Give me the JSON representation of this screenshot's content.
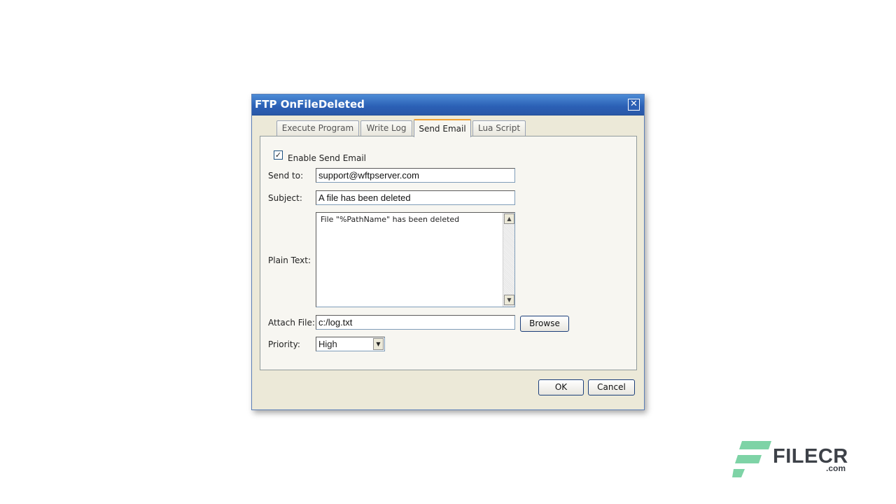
{
  "dialog": {
    "title": "FTP OnFileDeleted",
    "close_glyph": "✕"
  },
  "tabs": [
    {
      "label": "Execute Program",
      "active": false
    },
    {
      "label": "Write Log",
      "active": false
    },
    {
      "label": "Send Email",
      "active": true
    },
    {
      "label": "Lua Script",
      "active": false
    }
  ],
  "form": {
    "enable_checkbox": {
      "label": "Enable Send Email",
      "checked": true,
      "glyph": "✓"
    },
    "send_to": {
      "label": "Send to:",
      "value": "support@wftpserver.com"
    },
    "subject": {
      "label": "Subject:",
      "value": "A file has been deleted"
    },
    "plain_text": {
      "label": "Plain Text:",
      "value": "File \"%PathName\" has been deleted"
    },
    "attach_file": {
      "label": "Attach File:",
      "value": "c:/log.txt",
      "browse_label": "Browse"
    },
    "priority": {
      "label": "Priority:",
      "value": "High"
    }
  },
  "buttons": {
    "ok": "OK",
    "cancel": "Cancel"
  },
  "watermark": {
    "brand": "FILECR",
    "suffix": ".com",
    "colors": {
      "accent": "#7ed3a6",
      "text": "#3d4148"
    }
  },
  "colors": {
    "titlebar": "#2b5fb4",
    "dialog_bg": "#ece9d8",
    "active_tab_accent": "#f0a030"
  },
  "icons": {
    "scroll_up": "scroll-up-arrow-icon",
    "scroll_down": "scroll-down-arrow-icon",
    "dropdown": "chevron-down-icon"
  }
}
